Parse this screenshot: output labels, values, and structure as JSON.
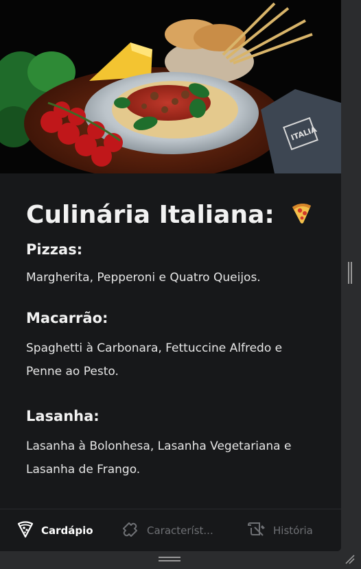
{
  "hero": {
    "image_description_icon": "italian-food-photo",
    "brand_text": "ITALIA"
  },
  "title": {
    "text": "Culinária Italiana:",
    "emoji": "pizza-icon"
  },
  "sections": [
    {
      "heading": "Pizzas:",
      "text": "Margherita, Pepperoni e Quatro Queijos."
    },
    {
      "heading": "Macarrão:",
      "text_line1": "Spaghetti à Carbonara, Fettuccine Alfredo e",
      "text_line2": "Penne ao Pesto."
    },
    {
      "heading": "Lasanha:",
      "text_line1": "Lasanha à Bolonhesa, Lasanha Vegetariana e",
      "text_line2": "Lasanha de Frango."
    }
  ],
  "nav": {
    "items": [
      {
        "label": "Cardápio",
        "icon": "pizza-slice-icon",
        "active": true
      },
      {
        "label": "Característ...",
        "icon": "puzzle-piece-icon",
        "active": false
      },
      {
        "label": "História",
        "icon": "scroll-icon",
        "active": false
      }
    ]
  },
  "colors": {
    "background": "#17181a",
    "text": "#f2f2f2",
    "nav_inactive": "#6f7175"
  }
}
